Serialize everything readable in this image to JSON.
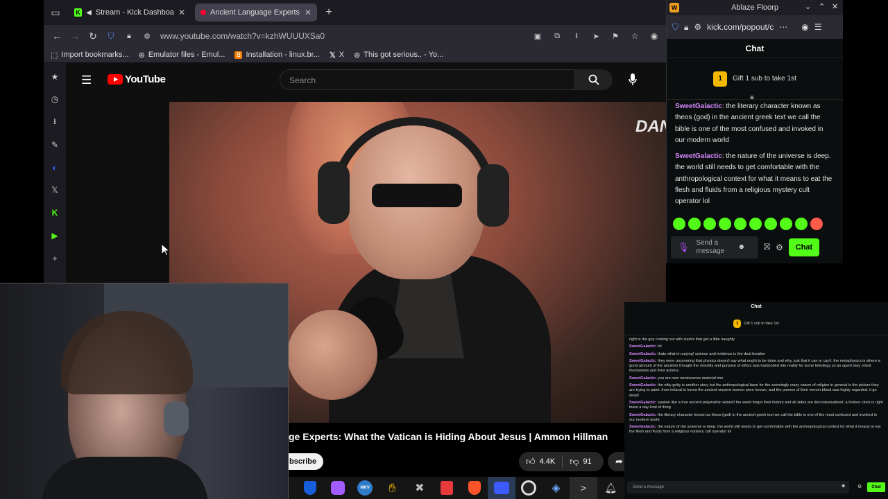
{
  "browser": {
    "tabs": [
      {
        "label": "Stream - Kick Dashboa",
        "icon": "kick-icon",
        "active": false
      },
      {
        "label": "Ancient Language Experts",
        "icon": "youtube-icon",
        "active": true
      }
    ],
    "url": "www.youtube.com/watch?v=kzhWUUUXSa0",
    "bookmarks": [
      {
        "label": "Import bookmarks...",
        "icon": "import-icon"
      },
      {
        "label": "Emulator files - Emul...",
        "icon": "globe-icon"
      },
      {
        "label": "Installation - linux.br...",
        "icon": "blogger-icon"
      },
      {
        "label": "X",
        "icon": "x-icon"
      },
      {
        "label": "This got serious.. - Yo...",
        "icon": "globe-icon"
      }
    ]
  },
  "youtube": {
    "logo_text": "YouTube",
    "search_placeholder": "Search",
    "watermark": "DAN",
    "video_title": "ge Experts: What the Vatican is Hiding About Jesus | Ammon Hillman",
    "subscribe_label": "bscribe",
    "likes": "4.4K",
    "dislikes": "91"
  },
  "kick_popout": {
    "window_title": "Ablaze Floorp",
    "url": "kick.com/popout/c",
    "chat_heading": "Chat",
    "gift_label": "Gift 1 sub to take 1st",
    "gift_count": "1",
    "messages": [
      {
        "user": "SweetGalactic",
        "text": "the literary character known as theos (god) in the ancient greek text we call the bible is one of the most confused and invoked in our modern world"
      },
      {
        "user": "SweetGalactic",
        "text": "the nature of the universe is deep. the world still needs to get comfortable with the anthropological context for what it means to eat the flesh and fluids from a religious mystery cult operator lol"
      }
    ],
    "input_placeholder": "Send a message",
    "chat_button": "Chat"
  },
  "chat_overlay": {
    "heading": "Chat",
    "gift_label": "Gift 1 sub to take 1st",
    "gift_count": "1",
    "first_line": "right is the guy coming out with claims that get a little naughty",
    "messages": [
      {
        "user": "SweetGalactic",
        "text": "lol"
      },
      {
        "user": "SweetGalactic",
        "text": "thats what im saying! science and evidence is the deal breaker"
      },
      {
        "user": "SweetGalactic",
        "text": "they were uncovering that physics doesn't say what ought to be done and why, just that it can or can't. the metaphysics is where a good amount of the ancients thought the morality and purpose of ethics was hardcoded into reality for some teleology so an agent may orient themselves and their actions."
      },
      {
        "user": "SweetGalactic",
        "text": "you are new renaissance material imo"
      },
      {
        "user": "SweetGalactic",
        "text": "the nitty gritty is another story but the anthropological base for the seemingly crazy nature of religion in general is the picture they are trying to paint. from ireland to korea the ancient serpent women were known, and the powers of their venom blood was highly regarded. it go deep!"
      },
      {
        "user": "SweetGalactic",
        "text": "spoken like a true ancient polymathic wizard! the world forgot their history and all sides are decontextualized. a broken clock is right twice a day kind of thing"
      },
      {
        "user": "SweetGalactic",
        "text": "the literary character known as theos (god) in the ancient greek text we call the bible is one of the most confused and invoked in our modern world"
      },
      {
        "user": "SweetGalactic",
        "text": "the nature of the universe is deep. the world still needs to get comfortable with the anthropological context for what it means to eat the flesh and fluids from a religious mystery cult operator lol"
      }
    ],
    "input_placeholder": "Send a message",
    "chat_button": "Chat"
  },
  "colors": {
    "kick_green": "#53fc18",
    "youtube_red": "#ff0000",
    "chat_username": "#d78bff"
  }
}
